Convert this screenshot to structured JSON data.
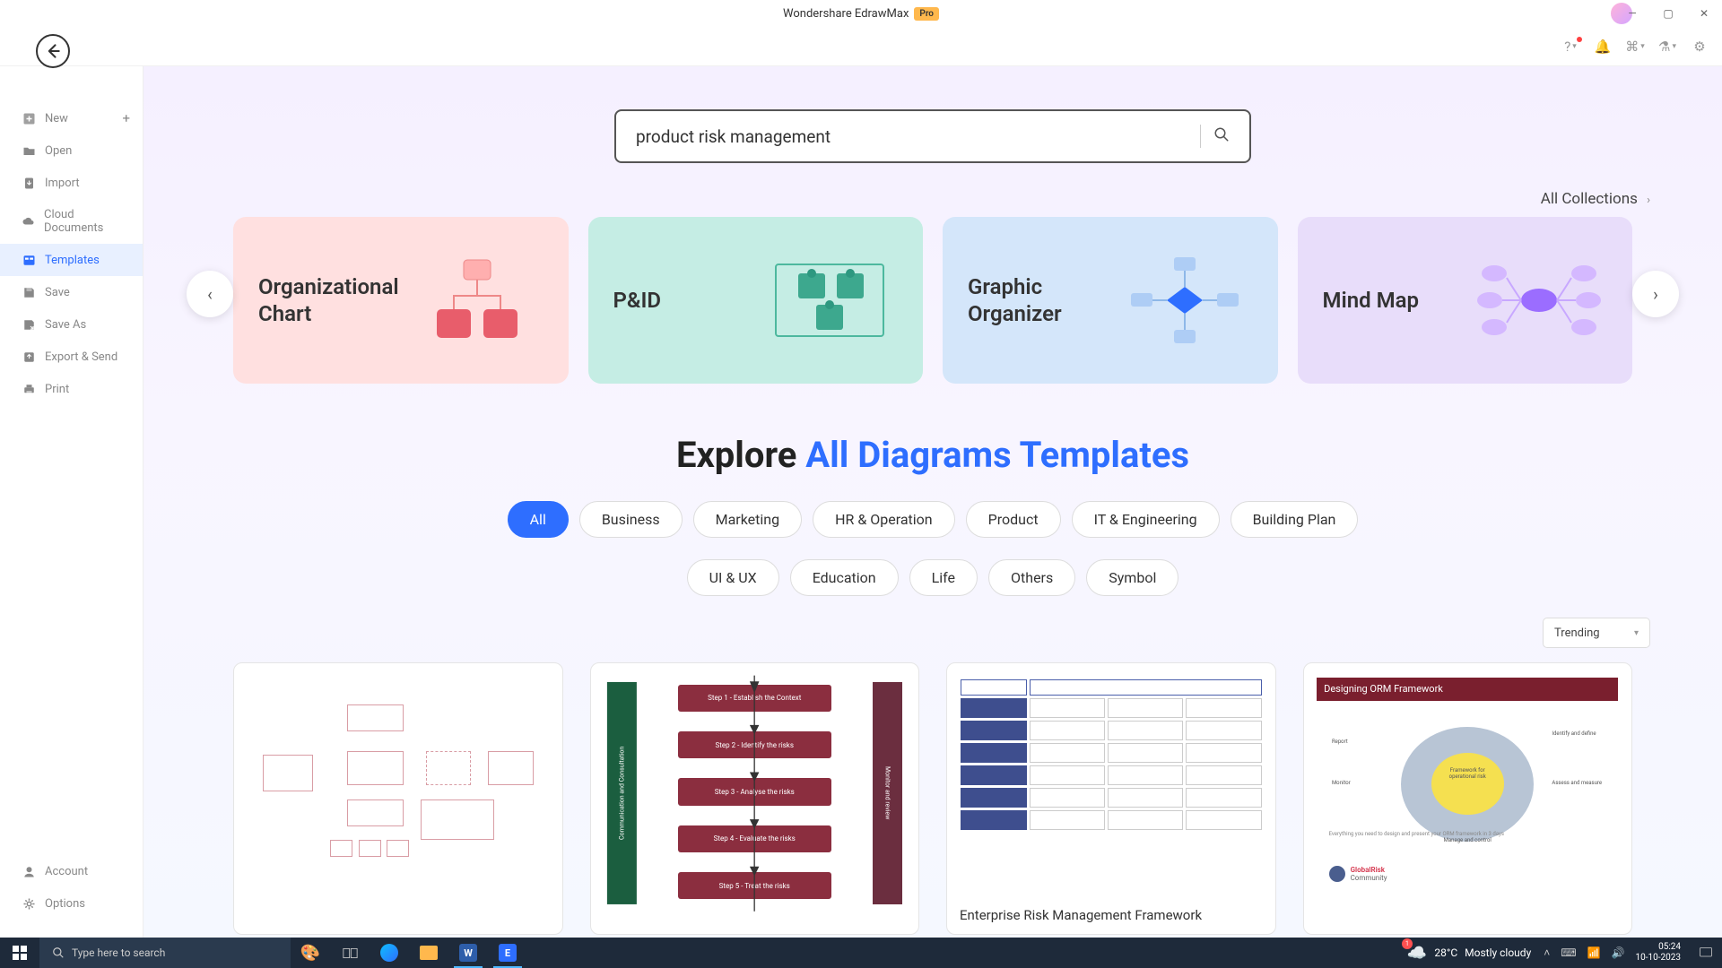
{
  "app": {
    "title": "Wondershare EdrawMax",
    "badge": "Pro"
  },
  "sidebar": {
    "top": [
      {
        "id": "new",
        "label": "New",
        "icon": "plus-square",
        "plus": true
      },
      {
        "id": "open",
        "label": "Open",
        "icon": "folder"
      },
      {
        "id": "import",
        "label": "Import",
        "icon": "download"
      },
      {
        "id": "cloud",
        "label": "Cloud Documents",
        "icon": "cloud"
      },
      {
        "id": "templates",
        "label": "Templates",
        "icon": "template",
        "active": true
      },
      {
        "id": "save",
        "label": "Save",
        "icon": "save"
      },
      {
        "id": "saveas",
        "label": "Save As",
        "icon": "saveas"
      },
      {
        "id": "export",
        "label": "Export & Send",
        "icon": "export"
      },
      {
        "id": "print",
        "label": "Print",
        "icon": "print"
      }
    ],
    "bottom": [
      {
        "id": "account",
        "label": "Account",
        "icon": "user"
      },
      {
        "id": "options",
        "label": "Options",
        "icon": "gear"
      }
    ]
  },
  "search": {
    "value": "product risk management"
  },
  "all_collections": "All Collections",
  "categories": [
    {
      "label": "Organizational Chart",
      "theme": "pink"
    },
    {
      "label": "P&ID",
      "theme": "teal"
    },
    {
      "label": "Graphic Organizer",
      "theme": "sky"
    },
    {
      "label": "Mind Map",
      "theme": "lilac"
    }
  ],
  "explore": {
    "prefix": "Explore ",
    "accent": "All Diagrams Templates"
  },
  "filters": {
    "row1": [
      "All",
      "Business",
      "Marketing",
      "HR & Operation",
      "Product",
      "IT & Engineering",
      "Building Plan"
    ],
    "row2": [
      "UI & UX",
      "Education",
      "Life",
      "Others",
      "Symbol"
    ],
    "active": "All"
  },
  "sort": {
    "selected": "Trending"
  },
  "templates": [
    {
      "title": "",
      "thumb": "boxes"
    },
    {
      "title": "",
      "thumb": "flow",
      "steps": [
        "Step 1 - Establish the Context",
        "Step 2 - Identify the risks",
        "Step 3 - Analyse the risks",
        "Step 4 - Evaluate the risks",
        "Step 5 - Treat the risks"
      ]
    },
    {
      "title": "Enterprise Risk Management Framework",
      "thumb": "matrix"
    },
    {
      "title": "",
      "thumb": "orm",
      "orm_title": "Designing ORM Framework",
      "orm_brand": "GlobalRisk",
      "orm_sub": "Community"
    }
  ],
  "taskbar": {
    "search_placeholder": "Type here to search",
    "weather_temp": "28°C",
    "weather_desc": "Mostly cloudy",
    "time": "05:24",
    "date": "10-10-2023"
  }
}
